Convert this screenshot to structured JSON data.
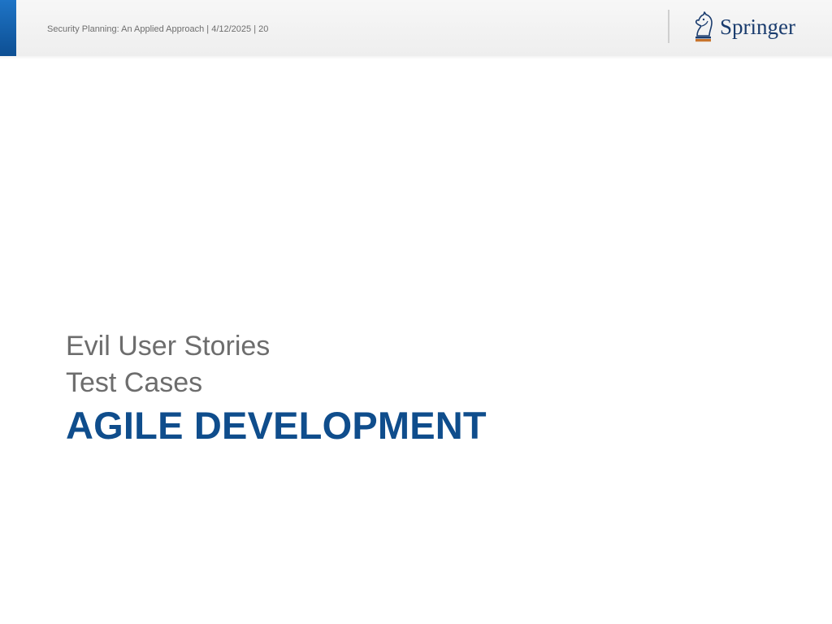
{
  "header": {
    "footer_text": "Security Planning: An Applied Approach | 4/12/2025 | 20",
    "logo": {
      "name": "springer-logo",
      "text": "Springer",
      "brand_color": "#1a3c6e",
      "emblem_color": "#c8742c"
    },
    "accent_color": "#1565b5"
  },
  "slide": {
    "subtitles": [
      "Evil User Stories",
      "Test Cases"
    ],
    "title": "AGILE DEVELOPMENT",
    "title_color": "#0f4d8c",
    "subtitle_color": "#6d6d6d"
  }
}
